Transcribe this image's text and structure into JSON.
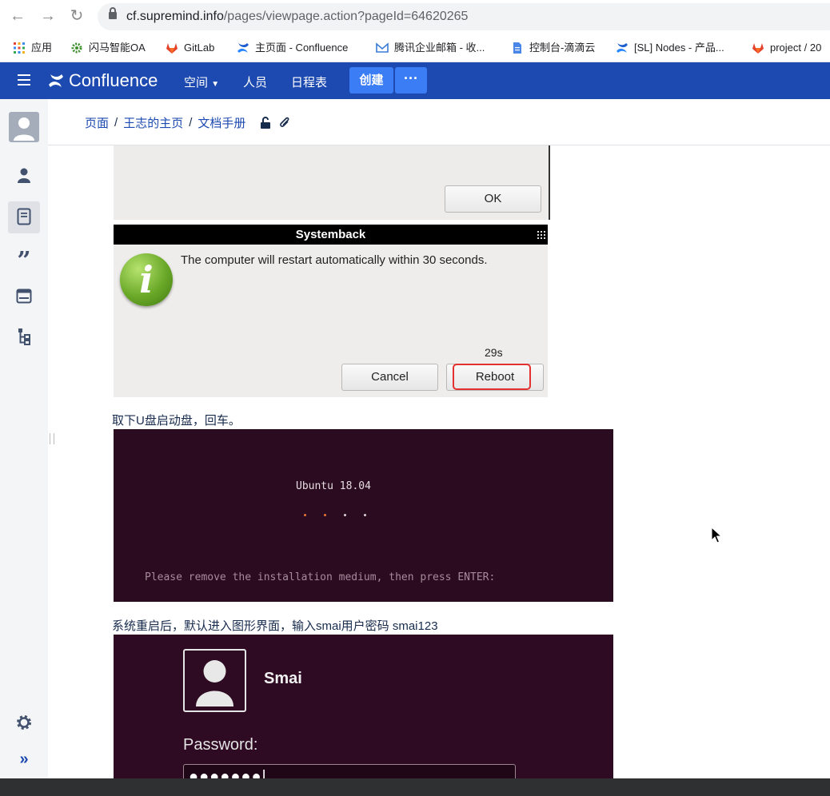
{
  "browser": {
    "url_host": "cf.supremind.info",
    "url_path": "/pages/viewpage.action?pageId=64620265",
    "bookmarks": [
      {
        "label": "应用",
        "icon": "apps-grid-icon"
      },
      {
        "label": "闪马智能OA",
        "icon": "gear-flower-icon"
      },
      {
        "label": "GitLab",
        "icon": "gitlab-icon"
      },
      {
        "label": "主页面 - Confluence",
        "icon": "confluence-icon"
      },
      {
        "label": "腾讯企业邮箱 - 收...",
        "icon": "mail-icon"
      },
      {
        "label": "控制台-滴滴云",
        "icon": "document-icon"
      },
      {
        "label": "[SL] Nodes - 产品...",
        "icon": "confluence-icon"
      },
      {
        "label": "project / 20",
        "icon": "gitlab-icon"
      }
    ]
  },
  "header": {
    "logo_text": "Confluence",
    "nav": [
      "空间",
      "人员",
      "日程表"
    ],
    "create_label": "创建",
    "more_label": "···"
  },
  "sidebar": {
    "icons": [
      "avatar-icon",
      "person-icon",
      "pages-icon",
      "quote-icon",
      "calendar-icon",
      "tree-icon",
      "settings-icon",
      "expand-icon"
    ]
  },
  "breadcrumb": [
    "页面",
    "王志的主页",
    "文档手册"
  ],
  "content": {
    "ok_dialog": {
      "ok_label": "OK"
    },
    "systemback": {
      "title": "Systemback",
      "message": "The computer will restart automatically within 30 seconds.",
      "countdown": "29s",
      "cancel_label": "Cancel",
      "reboot_label": "Reboot"
    },
    "caption1": "取下U盘启动盘，回车。",
    "ubuntu_screen": {
      "title": "Ubuntu 18.04",
      "message": "Please remove the installation medium, then press ENTER:"
    },
    "caption2": "系统重启后，默认进入图形界面，输入smai用户密码 smai123",
    "login_screen": {
      "username": "Smai",
      "password_label": "Password:",
      "password_mask": "●●●●●●●|"
    }
  },
  "colors": {
    "confluence_blue": "#1c4ab0",
    "create_button": "#3b7df4",
    "ubuntu_bg": "#2b0b1f",
    "highlight_red": "#e3312f"
  }
}
